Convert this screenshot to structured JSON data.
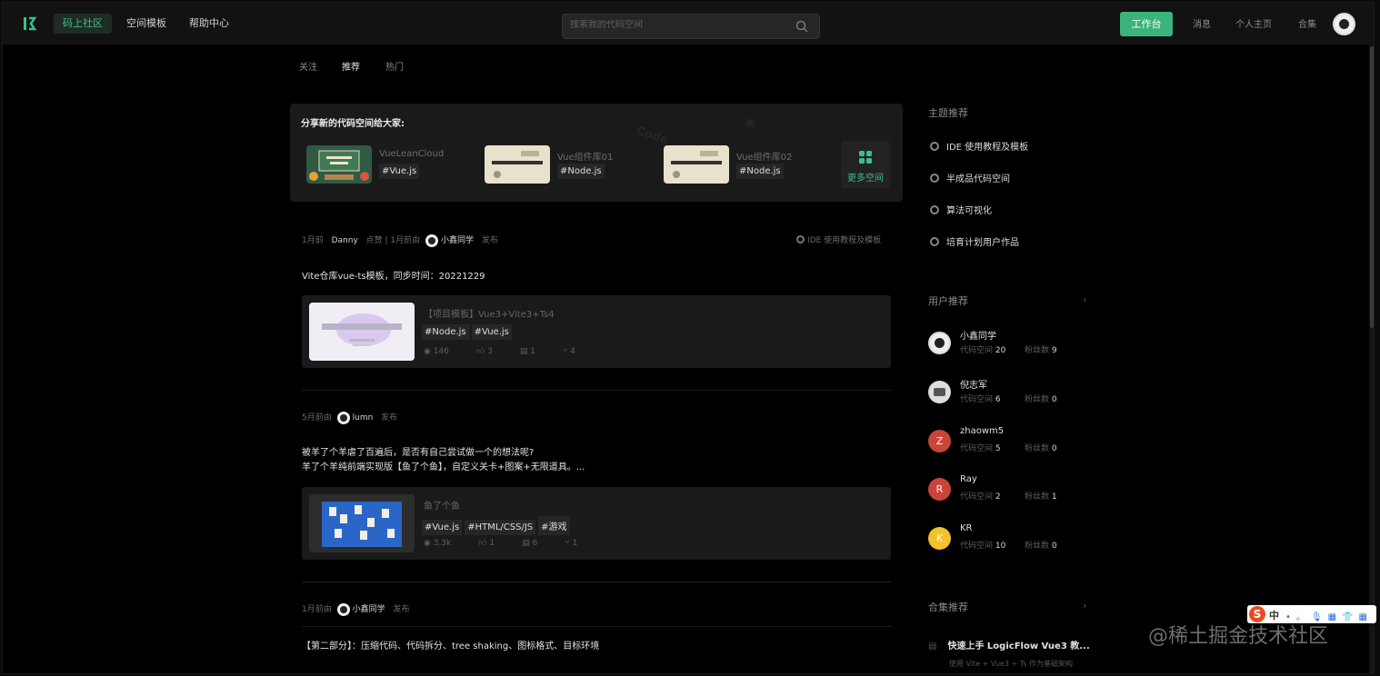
{
  "nav": {
    "links": [
      "码上社区",
      "空间模板",
      "帮助中心"
    ],
    "search_placeholder": "搜索我的代码空间",
    "workbench": "工作台",
    "right_links": [
      "消息",
      "个人主页",
      "合集"
    ]
  },
  "tabs": [
    "关注",
    "推荐",
    "热门"
  ],
  "share": {
    "title": "分享新的代码空间给大家:",
    "spaces": [
      {
        "name": "VueLeanCloud",
        "tag": "#Vue.js",
        "thumb_color": "#2e5a46"
      },
      {
        "name": "Vue组件库01",
        "tag": "#Node.js",
        "thumb_color": "#e8e1cc"
      },
      {
        "name": "Vue组件库02",
        "tag": "#Node.js",
        "thumb_color": "#e8e1cc"
      }
    ],
    "more": "更多空间"
  },
  "posts": [
    {
      "meta_pre": "1月前",
      "meta_user1": "Danny",
      "meta_mid": "点赞 | 1月前由",
      "author": "小鑫同学",
      "action": "发布",
      "topic": "IDE 使用教程及模板",
      "title": "Vite仓库vue-ts模板，同步时间：20221229",
      "card_name": "【项目模板】Vue3+Vite3+Ts4",
      "tags": [
        "#Node.js",
        "#Vue.js"
      ],
      "stats": [
        "146",
        "3",
        "1",
        "4"
      ]
    },
    {
      "meta_pre": "5月前由",
      "author": "lumn",
      "action": "发布",
      "title_lines": [
        "被羊了个羊虐了百遍后，是否有自己尝试做一个的想法呢?",
        "羊了个羊纯前端实现版【鱼了个鱼】，自定义关卡+图案+无限道具。..."
      ],
      "card_name": "鱼了个鱼",
      "tags": [
        "#Vue.js",
        "#HTML/CSS/JS",
        "#游戏"
      ],
      "stats": [
        "3.3k",
        "1",
        "6",
        "1"
      ]
    },
    {
      "meta_pre": "1月前由",
      "author": "小鑫同学",
      "action": "发布",
      "title": "【第二部分】：压缩代码、代码拆分、tree shaking、图标格式、目标环境"
    }
  ],
  "sidebar": {
    "topics_title": "主题推荐",
    "topics": [
      "IDE 使用教程及模板",
      "半成品代码空间",
      "算法可视化",
      "培育计划用户作品"
    ],
    "users_title": "用户推荐",
    "users": [
      {
        "name": "小鑫同学",
        "initial": "",
        "spaces": "20",
        "fans": "9",
        "color": "#eeeeee"
      },
      {
        "name": "倪志军",
        "initial": "",
        "spaces": "6",
        "fans": "0",
        "color": "#dddddd"
      },
      {
        "name": "zhaowm5",
        "initial": "Z",
        "spaces": "5",
        "fans": "0",
        "color": "#c9443a"
      },
      {
        "name": "Ray",
        "initial": "R",
        "spaces": "2",
        "fans": "1",
        "color": "#c9443a"
      },
      {
        "name": "KR",
        "initial": "K",
        "spaces": "10",
        "fans": "0",
        "color": "#f2c12e"
      }
    ],
    "space_label": "代码空间",
    "fans_label": "粉丝数",
    "collections_title": "合集推荐",
    "collection_item": "快速上手 LogicFlow Vue3 教...",
    "collection_sub": "使用 Vite + Vue3 + Ts 作为基础架构"
  },
  "watermark": "@稀土掘金技术社区",
  "ime": {
    "logo": "S",
    "cn": "中"
  },
  "colors": {
    "accent": "#39c088",
    "button": "#3ab37c",
    "bg": "#000000",
    "card": "#1a1a1a"
  }
}
